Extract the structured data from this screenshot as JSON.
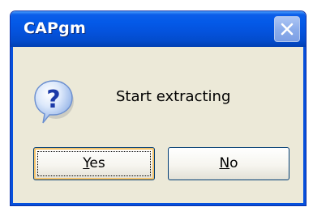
{
  "window": {
    "title": "CAPgm"
  },
  "dialog": {
    "message": "Start extracting",
    "icon": "question-icon"
  },
  "buttons": {
    "yes": {
      "accel": "Y",
      "rest": "es"
    },
    "no": {
      "accel": "N",
      "rest": "o"
    }
  },
  "colors": {
    "titlebar": "#0453de",
    "dialog_background": "#ece9d8",
    "button_border": "#003c74"
  }
}
